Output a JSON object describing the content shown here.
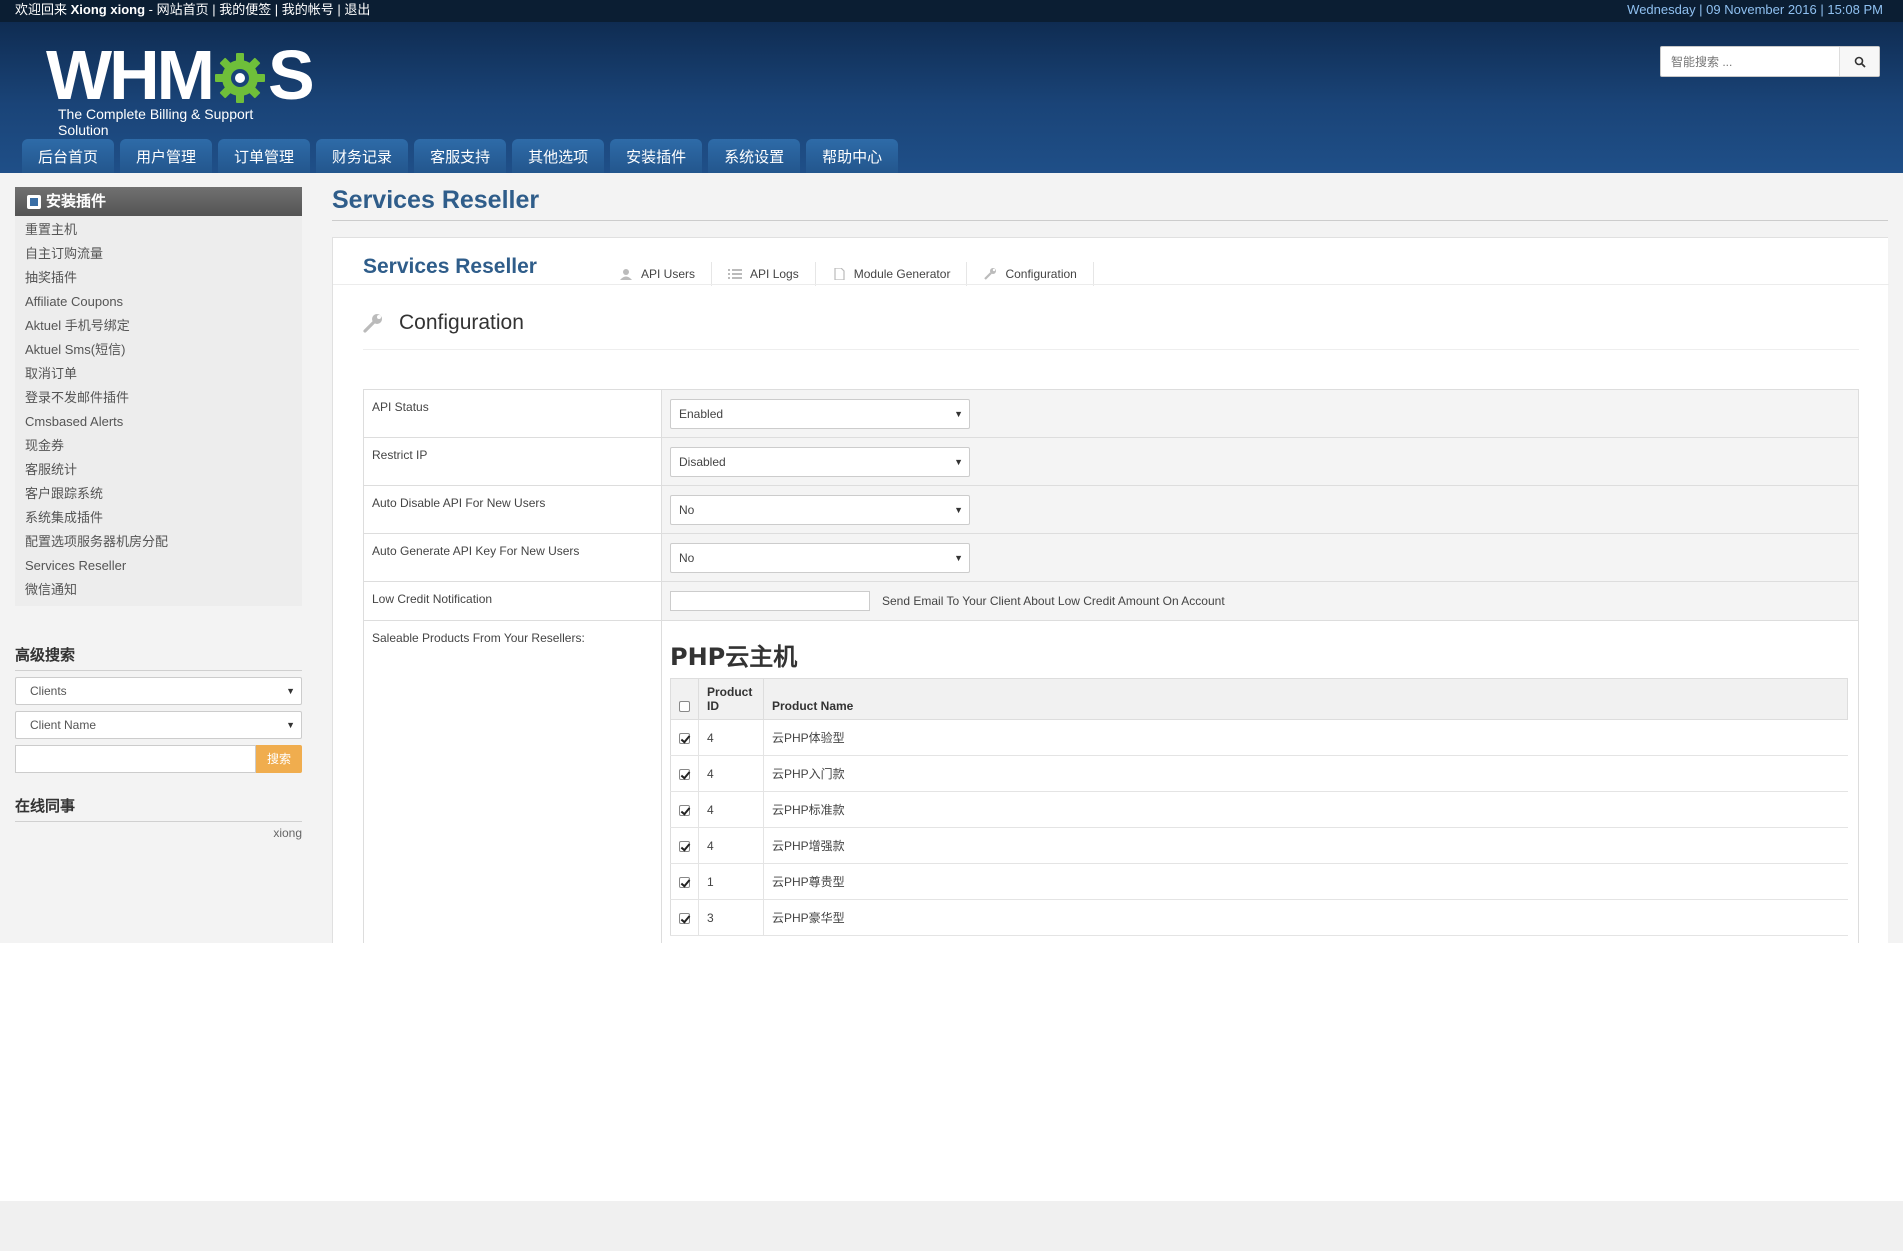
{
  "topbar": {
    "welcome": "欢迎回来",
    "user": "Xiong xiong",
    "links": "- 网站首页 | 我的便签 | 我的帐号 | 退出",
    "datetime": "Wednesday | 09 November 2016 | 15:08 PM"
  },
  "logo": {
    "text_left": "WHM",
    "text_right": "S",
    "tagline": "The Complete Billing & Support Solution"
  },
  "search": {
    "placeholder": "智能搜索 ..."
  },
  "nav": [
    "后台首页",
    "用户管理",
    "订单管理",
    "财务记录",
    "客服支持",
    "其他选项",
    "安装插件",
    "系统设置",
    "帮助中心"
  ],
  "sidebar": {
    "title": "安装插件",
    "items": [
      "重置主机",
      "自主订购流量",
      "抽奖插件",
      "Affiliate Coupons",
      "Aktuel 手机号绑定",
      "Aktuel Sms(短信)",
      "取消订单",
      "登录不发邮件插件",
      "Cmsbased Alerts",
      "现金券",
      "客服统计",
      "客户跟踪系统",
      "系统集成插件",
      "配置选项服务器机房分配",
      "Services Reseller",
      "微信通知"
    ],
    "advanced_search": {
      "title": "高级搜索",
      "select1": "Clients",
      "select2": "Client Name",
      "button": "搜索"
    },
    "online": {
      "title": "在线同事",
      "names": "xiong"
    }
  },
  "main": {
    "page_title": "Services Reseller",
    "panel_title": "Services Reseller",
    "tabs": [
      {
        "label": "API Users",
        "icon": "user-icon"
      },
      {
        "label": "API Logs",
        "icon": "list-icon"
      },
      {
        "label": "Module Generator",
        "icon": "file-icon"
      },
      {
        "label": "Configuration",
        "icon": "wrench-icon"
      }
    ],
    "section_title": "Configuration",
    "form": {
      "api_status": {
        "label": "API Status",
        "value": "Enabled"
      },
      "restrict_ip": {
        "label": "Restrict IP",
        "value": "Disabled"
      },
      "auto_disable": {
        "label": "Auto Disable API For New Users",
        "value": "No"
      },
      "auto_generate": {
        "label": "Auto Generate API Key For New Users",
        "value": "No"
      },
      "low_credit": {
        "label": "Low Credit Notification",
        "value": "",
        "hint": "Send Email To Your Client About Low Credit Amount On Account"
      },
      "saleable": {
        "label": "Saleable Products From Your Resellers:"
      }
    },
    "product_group": {
      "title": "PHP云主机",
      "columns": [
        "Product ID",
        "Product Name"
      ],
      "rows": [
        {
          "id": "4",
          "name": "云PHP体验型",
          "checked": true
        },
        {
          "id": "4",
          "name": "云PHP入门款",
          "checked": true
        },
        {
          "id": "4",
          "name": "云PHP标准款",
          "checked": true
        },
        {
          "id": "4",
          "name": "云PHP增强款",
          "checked": true
        },
        {
          "id": "1",
          "name": "云PHP尊贵型",
          "checked": true
        },
        {
          "id": "3",
          "name": "云PHP豪华型",
          "checked": true
        }
      ]
    }
  },
  "colors": {
    "topbar": "#0b1e33",
    "header": "#1a4478",
    "nav_tab": "#2a6199",
    "title": "#2f5d8a",
    "accent_green": "#6fbf3a",
    "search_btn": "#f0ad4e"
  }
}
